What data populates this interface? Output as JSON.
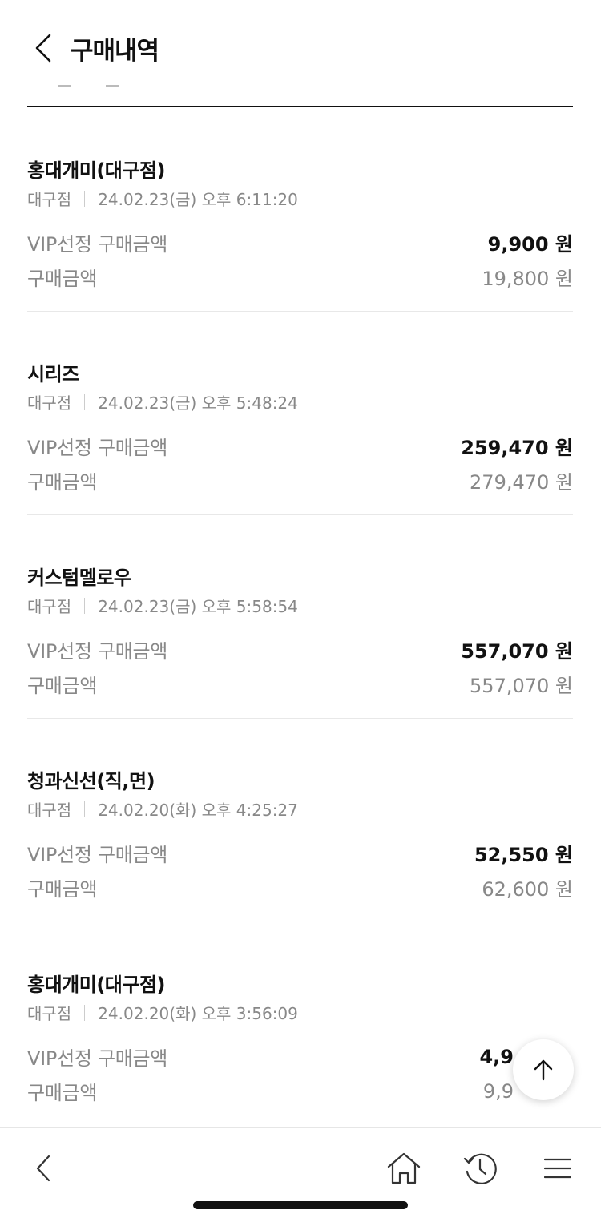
{
  "header": {
    "title": "구매내역"
  },
  "orders": [
    {
      "store": "홍대개미(대구점)",
      "branch": "대구점",
      "datetime": "24.02.23(금) 오후 6:11:20",
      "vip_label": "VIP선정 구매금액",
      "vip_amount": "9,900 원",
      "total_label": "구매금액",
      "total_amount": "19,800 원"
    },
    {
      "store": "시리즈",
      "branch": "대구점",
      "datetime": "24.02.23(금) 오후 5:48:24",
      "vip_label": "VIP선정 구매금액",
      "vip_amount": "259,470 원",
      "total_label": "구매금액",
      "total_amount": "279,470 원"
    },
    {
      "store": "커스텀멜로우",
      "branch": "대구점",
      "datetime": "24.02.23(금) 오후 5:58:54",
      "vip_label": "VIP선정 구매금액",
      "vip_amount": "557,070 원",
      "total_label": "구매금액",
      "total_amount": "557,070 원"
    },
    {
      "store": "청과신선(직,면)",
      "branch": "대구점",
      "datetime": "24.02.20(화) 오후 4:25:27",
      "vip_label": "VIP선정 구매금액",
      "vip_amount": "52,550 원",
      "total_label": "구매금액",
      "total_amount": "62,600 원"
    },
    {
      "store": "홍대개미(대구점)",
      "branch": "대구점",
      "datetime": "24.02.20(화) 오후 3:56:09",
      "vip_label": "VIP선정 구매금액",
      "vip_amount": "4,9",
      "total_label": "구매금액",
      "total_amount": "9,9"
    }
  ],
  "icons": {
    "header_back": "chevron-left-icon",
    "scroll_top": "arrow-up-icon",
    "nav_back": "chevron-left-icon",
    "nav_home": "home-icon",
    "nav_history": "history-icon",
    "nav_menu": "menu-icon"
  },
  "colors": {
    "text_primary": "#111111",
    "text_secondary": "#888888",
    "divider": "#e8e8e8"
  }
}
